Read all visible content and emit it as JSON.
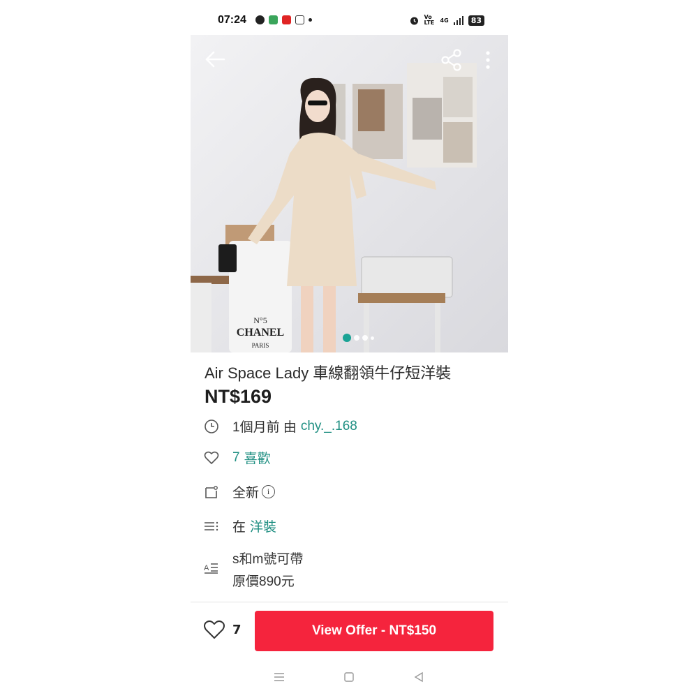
{
  "status_bar": {
    "time": "07:24",
    "network": "4G",
    "volte": "Vo LTE",
    "battery": "83"
  },
  "hero": {
    "image_alt": "Woman in beige wrap mini dress posing by wall",
    "slide_count": 4,
    "active_slide": 1
  },
  "listing": {
    "title": "Air Space Lady 車線翻領牛仔短洋裝",
    "price": "NT$169",
    "posted": "1個月前 由",
    "seller": "chy._.168",
    "likes_count": "7",
    "likes_label": "喜歡",
    "condition": "全新",
    "category_prefix": "在",
    "category": "洋裝",
    "description_line1": "s和m號可帶",
    "description_line2": "原價890元"
  },
  "bottom_bar": {
    "like_count": "7",
    "offer_button": "View Offer - NT$150"
  },
  "colors": {
    "accent_teal": "#1f8f82",
    "offer_red": "#f5243d"
  }
}
